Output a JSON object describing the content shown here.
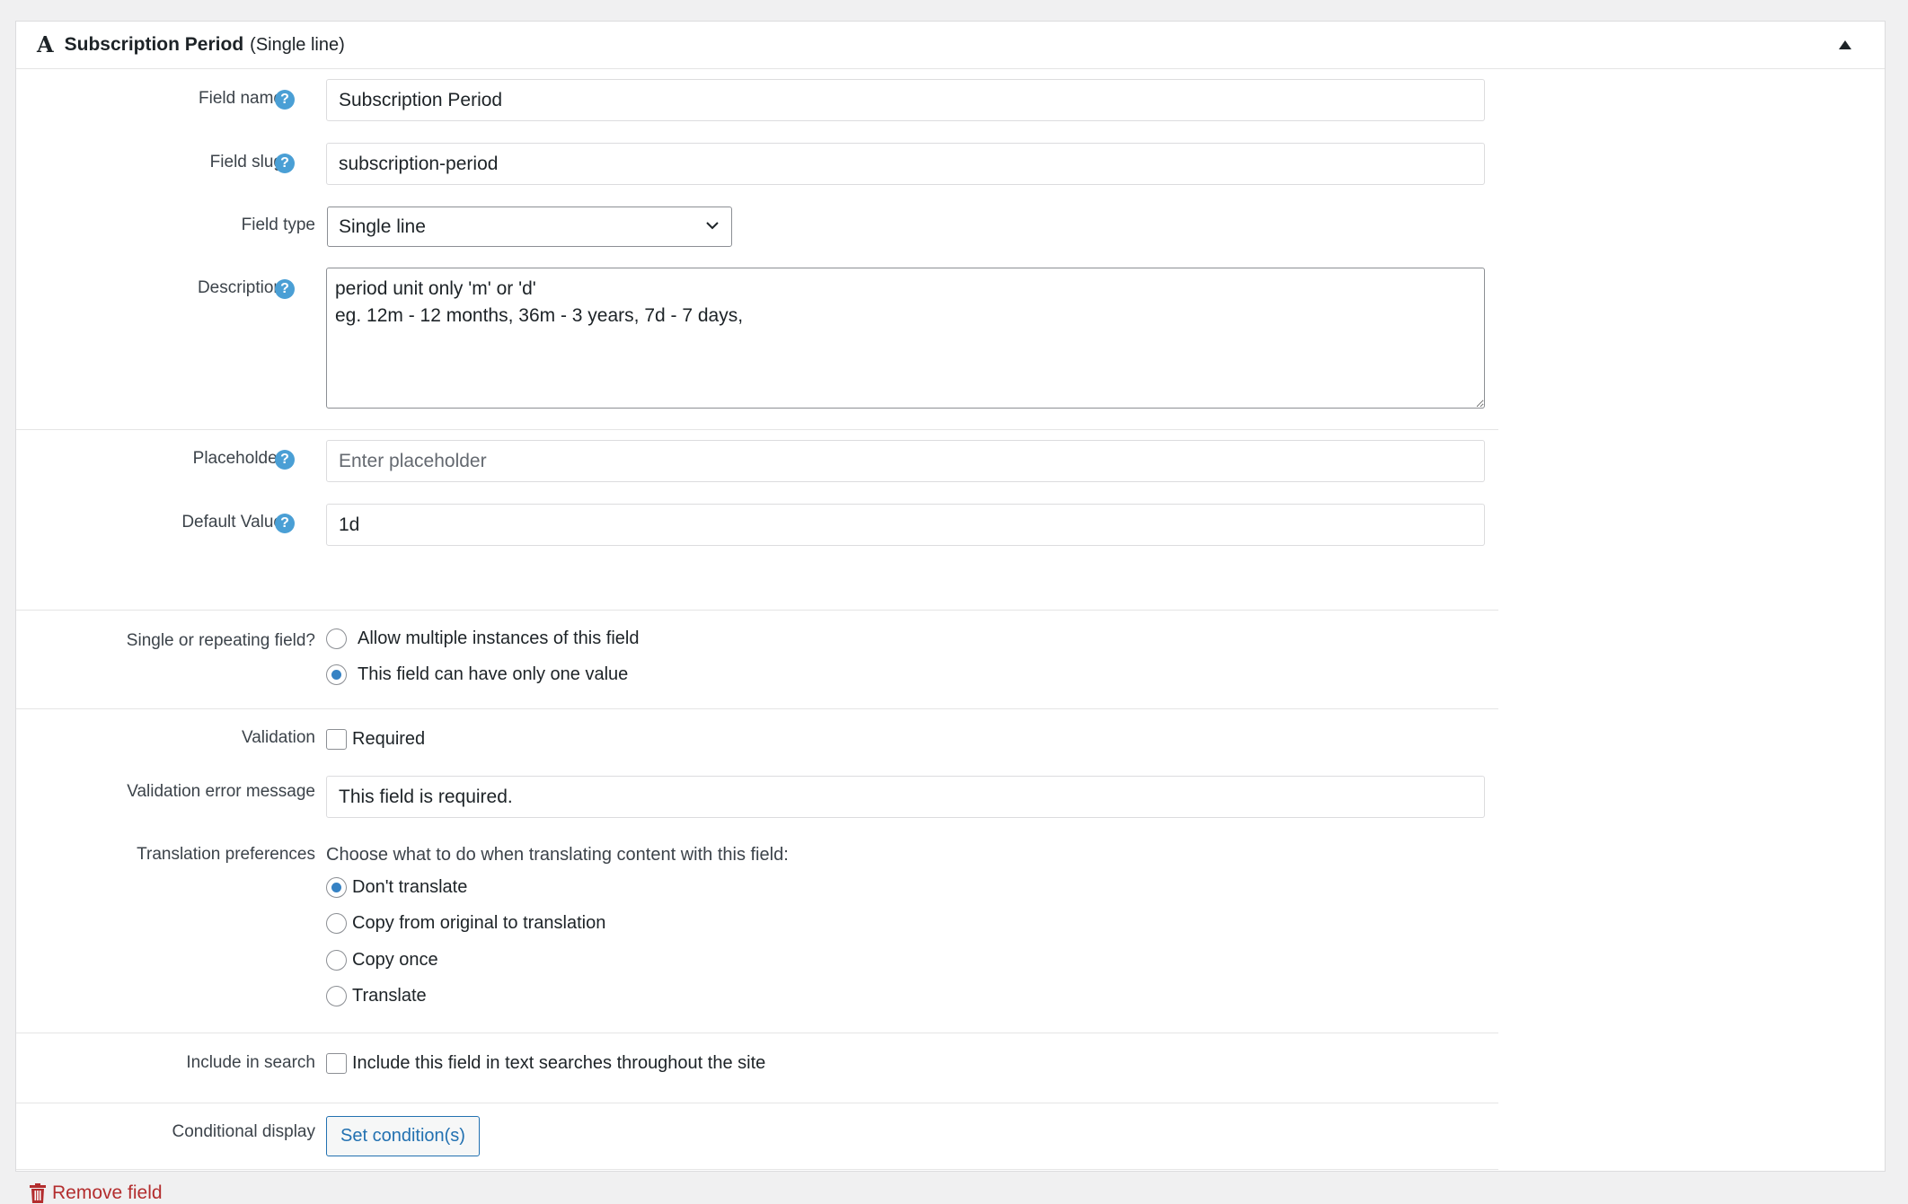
{
  "header": {
    "title": "Subscription Period",
    "subtitle": "(Single line)",
    "type_icon": "A",
    "collapse_icon": "triangle-up-icon"
  },
  "help_glyph": "?",
  "fields": {
    "field_name": {
      "label": "Field name",
      "value": "Subscription Period"
    },
    "field_slug": {
      "label": "Field slug",
      "value": "subscription-period"
    },
    "field_type": {
      "label": "Field type",
      "selected": "Single line"
    },
    "description": {
      "label": "Description",
      "value": "period unit only 'm' or 'd'\neg. 12m - 12 months, 36m - 3 years, 7d - 7 days,"
    },
    "placeholder": {
      "label": "Placeholder",
      "placeholder": "Enter placeholder",
      "value": ""
    },
    "default_value": {
      "label": "Default Value",
      "value": "1d"
    },
    "repeating": {
      "label": "Single or repeating field?",
      "options": [
        "Allow multiple instances of this field",
        "This field can have only one value"
      ],
      "selected_index": 1
    },
    "validation": {
      "label": "Validation",
      "checkbox_label": "Required",
      "checked": false
    },
    "validation_error": {
      "label": "Validation error message",
      "value": "This field is required."
    },
    "translation": {
      "label": "Translation preferences",
      "note": "Choose what to do when translating content with this field:",
      "options": [
        "Don't translate",
        "Copy from original to translation",
        "Copy once",
        "Translate"
      ],
      "selected_index": 0
    },
    "include_search": {
      "label": "Include in search",
      "checkbox_label": "Include this field in text searches throughout the site",
      "checked": false
    },
    "conditional": {
      "label": "Conditional display",
      "button_label": "Set condition(s)"
    }
  },
  "remove_label": "Remove field",
  "colors": {
    "accent": "#2271b1",
    "help": "#4a9fd5",
    "danger": "#b32d2e",
    "radio_on": "#3582c4"
  }
}
